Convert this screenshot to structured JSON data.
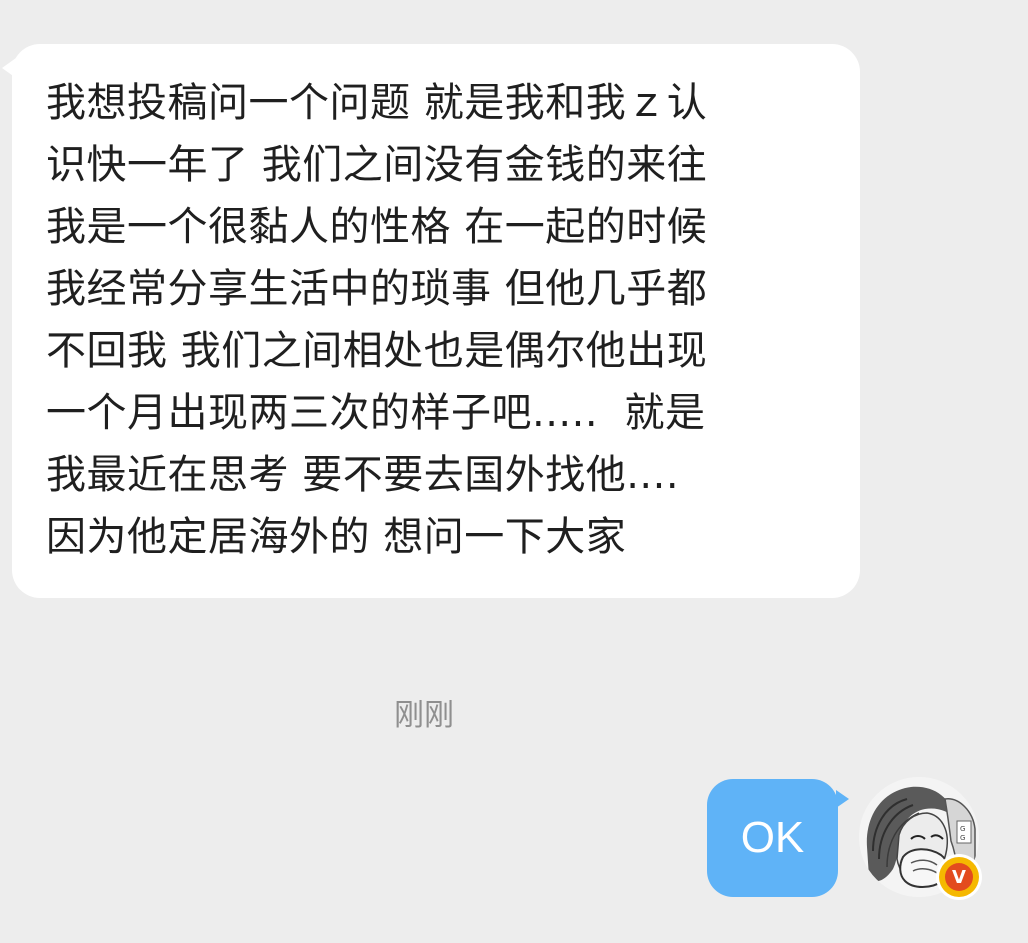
{
  "incoming_message": {
    "lines": [
      "我想投稿问一个问题 就是我和我ｚ认",
      "识快一年了 我们之间没有金钱的来往",
      "我是一个很黏人的性格 在一起的时候",
      "我经常分享生活中的琐事 但他几乎都",
      "不回我 我们之间相处也是偶尔他出现",
      "一个月出现两三次的样子吧.....  就是",
      "我最近在思考 要不要去国外找他....",
      "因为他定居海外的 想问一下大家"
    ]
  },
  "timestamp": "刚刚",
  "outgoing_message": {
    "text": "OK"
  },
  "avatar": {
    "icon": "user-avatar-manga-sketch",
    "badge_icon": "verified-v-badge-icon",
    "badge_letter": "V"
  },
  "colors": {
    "background": "#ededed",
    "incoming_bubble": "#ffffff",
    "outgoing_bubble": "#5fb3f7",
    "text": "#1f1f1f",
    "timestamp": "#8f8f8f",
    "badge_outer": "#f5b800",
    "badge_inner": "#e34b1e"
  }
}
